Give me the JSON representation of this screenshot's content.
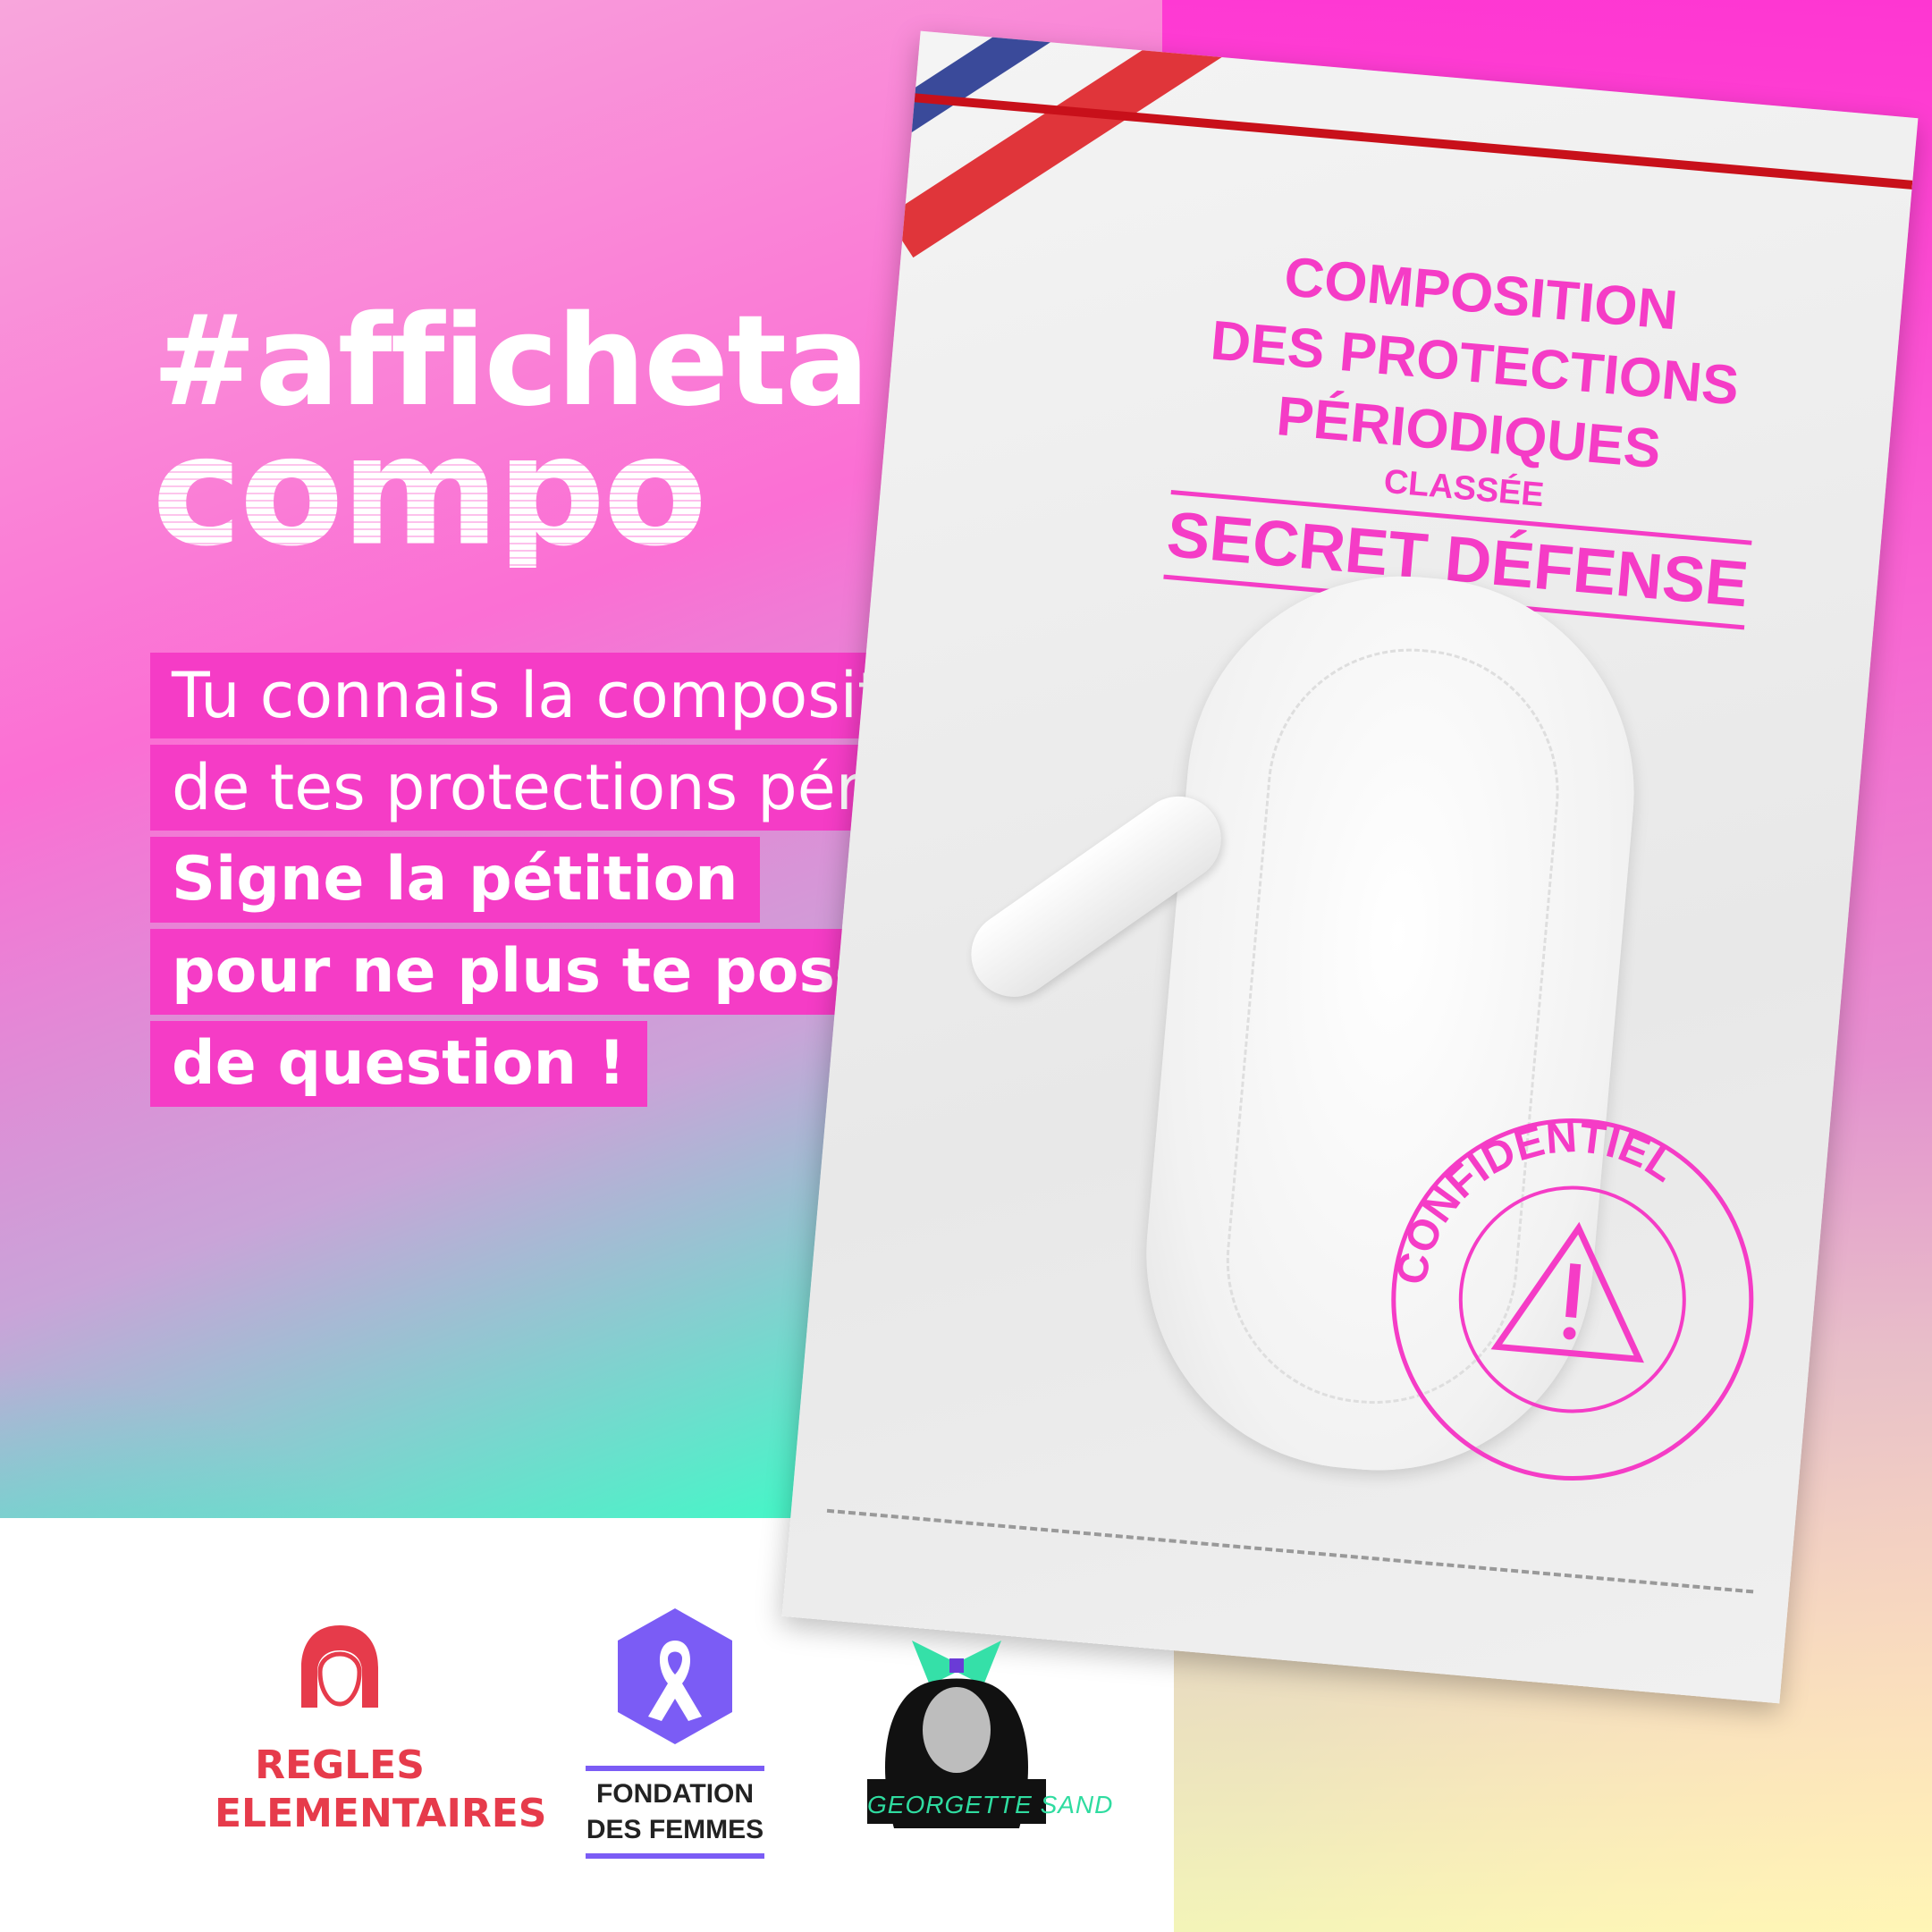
{
  "hashtag": {
    "line1": "#afficheta",
    "line2": "compo"
  },
  "message": {
    "lines": [
      "Tu connais la composition",
      "de tes protections périodiques ?",
      "Signe la pétition",
      "pour ne plus te poser",
      "de question !"
    ]
  },
  "bag": {
    "title_lines": [
      "COMPOSITION",
      "DES PROTECTIONS",
      "PÉRIODIQUES"
    ],
    "classification": "CLASSÉE",
    "secret": "SECRET DÉFENSE",
    "seal_text": "CONFIDENTIEL"
  },
  "logos": {
    "regles": {
      "line1": "REGLES",
      "line2": "ELEMENTAIRES",
      "icon": "woman-head-icon"
    },
    "fondation": {
      "line1": "FONDATION",
      "line2": "DES FEMMES",
      "icon": "ribbon-hexagon-icon"
    },
    "georgette": {
      "text": "GEORGETTE SAND"
    }
  },
  "colors": {
    "accent_pink": "#f53cc6",
    "logo_red": "#e63b4b",
    "logo_purple": "#7b5cf5",
    "mint": "#2fdca0"
  }
}
